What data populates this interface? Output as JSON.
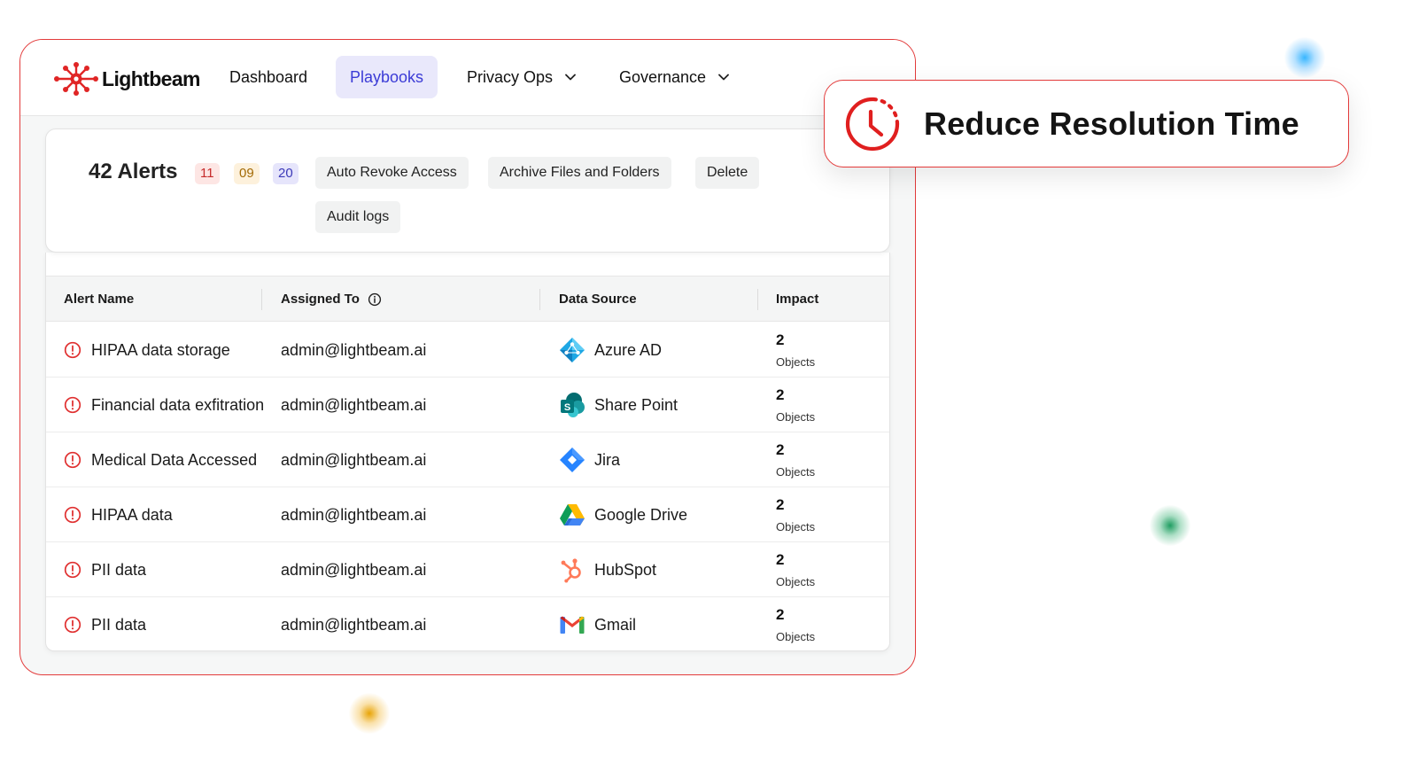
{
  "colors": {
    "accent_red": "#e33b3b",
    "nav_active_bg": "#e9e8fb",
    "nav_active_text": "#3b3bd6"
  },
  "brand": {
    "name": "Lightbeam",
    "logo_icon": "lightbeam-logo-icon"
  },
  "nav": {
    "items": [
      {
        "label": "Dashboard",
        "active": false,
        "has_dropdown": false
      },
      {
        "label": "Playbooks",
        "active": true,
        "has_dropdown": false
      },
      {
        "label": "Privacy Ops",
        "active": false,
        "has_dropdown": true
      },
      {
        "label": "Governance",
        "active": false,
        "has_dropdown": true
      }
    ]
  },
  "alerts": {
    "title": "42 Alerts",
    "badges": [
      {
        "value": "11",
        "color": "#c62b2b"
      },
      {
        "value": "09",
        "color": "#a36a05"
      },
      {
        "value": "20",
        "color": "#3c3ab8"
      }
    ],
    "actions": [
      "Auto Revoke Access",
      "Archive Files and Folders",
      "Delete",
      "Audit logs"
    ]
  },
  "table": {
    "columns": [
      "Alert Name",
      "Assigned To",
      "Data Source",
      "Impact"
    ],
    "assigned_info_icon": "info-icon",
    "rows": [
      {
        "alert": "HIPAA data storage",
        "assigned": "admin@lightbeam.ai",
        "source": "Azure AD",
        "source_icon": "azure-ad-icon",
        "impact": "2",
        "impact_unit": "Objects"
      },
      {
        "alert": "Financial data exfitration",
        "assigned": "admin@lightbeam.ai",
        "source": "Share Point",
        "source_icon": "sharepoint-icon",
        "impact": "2",
        "impact_unit": "Objects"
      },
      {
        "alert": "Medical Data Accessed",
        "assigned": "admin@lightbeam.ai",
        "source": "Jira",
        "source_icon": "jira-icon",
        "impact": "2",
        "impact_unit": "Objects"
      },
      {
        "alert": "HIPAA data",
        "assigned": "admin@lightbeam.ai",
        "source": "Google Drive",
        "source_icon": "google-drive-icon",
        "impact": "2",
        "impact_unit": "Objects"
      },
      {
        "alert": "PII data",
        "assigned": "admin@lightbeam.ai",
        "source": "HubSpot",
        "source_icon": "hubspot-icon",
        "impact": "2",
        "impact_unit": "Objects"
      },
      {
        "alert": "PII data",
        "assigned": "admin@lightbeam.ai",
        "source": "Gmail",
        "source_icon": "gmail-icon",
        "impact": "2",
        "impact_unit": "Objects"
      }
    ]
  },
  "callout": {
    "text": "Reduce Resolution Time",
    "icon": "clock-icon"
  }
}
